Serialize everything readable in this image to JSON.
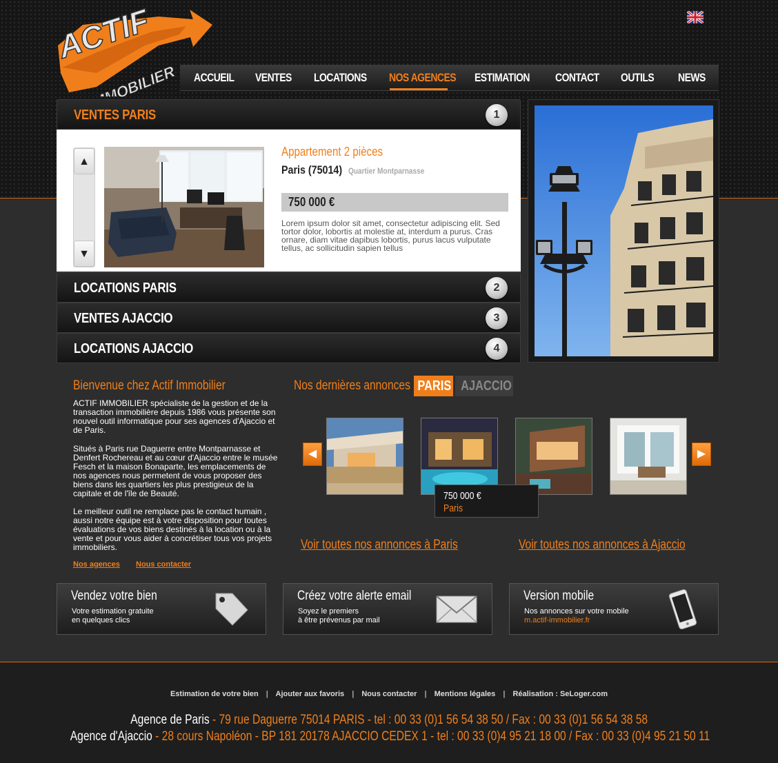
{
  "logo": {
    "line1": "ACTIF",
    "line2": "IMMOBILIER"
  },
  "language_flag": "uk-flag-icon",
  "nav": {
    "items": [
      {
        "label": "ACCUEIL"
      },
      {
        "label": "VENTES"
      },
      {
        "label": "LOCATIONS"
      },
      {
        "label": "NOS AGENCES",
        "active": true
      },
      {
        "label": "ESTIMATION"
      },
      {
        "label": "CONTACT"
      },
      {
        "label": "OUTILS"
      },
      {
        "label": "NEWS"
      }
    ]
  },
  "accordion": [
    {
      "title": "VENTES PARIS",
      "number": "1",
      "open": true
    },
    {
      "title": "LOCATIONS PARIS",
      "number": "2"
    },
    {
      "title": "VENTES AJACCIO",
      "number": "3"
    },
    {
      "title": "LOCATIONS AJACCIO",
      "number": "4"
    }
  ],
  "featured": {
    "type": "Appartement 2 pièces",
    "city": "Paris (75014)",
    "district": "Quartier Montparnasse",
    "price": "750 000 €",
    "description": "Lorem ipsum dolor sit amet, consectetur adipiscing elit. Sed tortor dolor, lobortis at molestie at, interdum a purus. Cras ornare, diam vitae dapibus lobortis, purus lacus vulputate tellus, ac sollicitudin sapien tellus"
  },
  "welcome": {
    "title": "Bienvenue chez Actif Immobilier",
    "paragraphs": [
      "ACTIF IMMOBILIER spécialiste de la gestion et de la transaction immobilière depuis 1986 vous présente son nouvel outil informatique pour ses agences d'Ajaccio et de Paris.",
      "Situés à Paris rue Daguerre entre Montparnasse et Denfert Rochereau et au cœur d'Ajaccio entre le musée Fesch et la maison Bonaparte, les emplacements de nos agences nous permetent de vous proposer des biens dans les quartiers les plus prestigieux de la capitale et de l'île de Beauté.",
      "Le meilleur outil ne remplace pas le contact humain , aussi notre équipe est à votre disposition pour toutes évaluations de vos biens destinés à la location ou à la vente et pour vous aider à concrétiser tous vos projets immobiliers."
    ],
    "links": [
      "Nos agences",
      "Nous contacter"
    ]
  },
  "latest": {
    "title": "Nos dernières annonces à",
    "tabs": [
      {
        "label": "PARIS",
        "active": true
      },
      {
        "label": "AJACCIO"
      }
    ],
    "tooltip": {
      "price": "750 000 €",
      "city": "Paris"
    },
    "see_all_paris": "Voir toutes nos annonces à Paris",
    "see_all_ajaccio": "Voir toutes nos annonces à Ajaccio"
  },
  "promos": [
    {
      "title": "Vendez votre bien",
      "line1": "Votre estimation gratuite",
      "line2": "en quelques clics",
      "icon": "price-tag-icon"
    },
    {
      "title": "Créez votre alerte email",
      "line1": "Soyez le premiers",
      "line2": "à être prévenus par mail",
      "icon": "envelope-icon"
    },
    {
      "title": "Version mobile",
      "line1": "Nos annonces sur votre mobile",
      "line2": "m.actif-immobilier.fr",
      "icon": "smartphone-icon"
    }
  ],
  "footer": {
    "links": [
      "Estimation de votre bien",
      "Ajouter aux favoris",
      "Nous contacter",
      "Mentions légales",
      "Réalisation : SeLoger.com"
    ],
    "separator": "|",
    "paris": {
      "name": "Agence de Paris",
      "address": " - 79 rue Daguerre 75014 PARIS - tel : 00 33 (0)1 56 54 38 50 / Fax : 00 33 (0)1 56 54 38 58"
    },
    "ajaccio": {
      "name": "Agence d'Ajaccio",
      "address": " - 28 cours Napoléon - BP 181 20178 AJACCIO CEDEX 1 - tel : 00 33 (0)4 95 21 18 00  / Fax : 00 33 (0)4 95 21 50 11"
    }
  },
  "colors": {
    "accent": "#f07f1b",
    "background": "#2d2d2d"
  }
}
